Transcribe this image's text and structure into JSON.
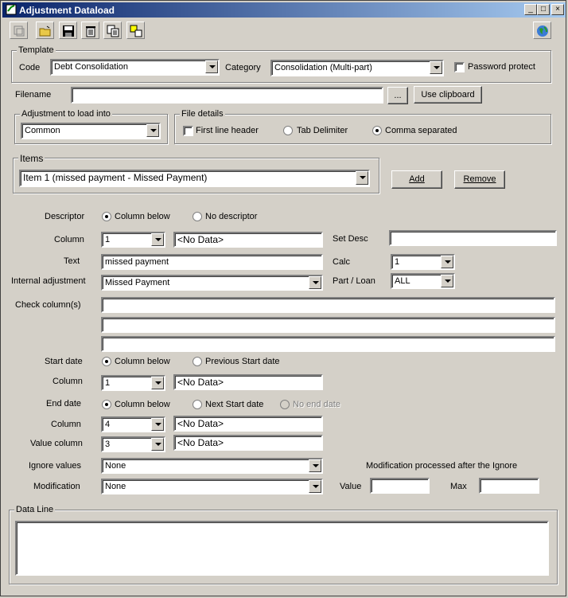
{
  "window": {
    "title": "Adjustment Dataload"
  },
  "toolbar": {
    "buttons": [
      "new-icon",
      "open-icon",
      "save-icon",
      "delete-icon",
      "copy-icon",
      "swap-icon"
    ],
    "help": "globe-icon"
  },
  "template": {
    "legend": "Template",
    "code_label": "Code",
    "code_value": "Debt Consolidation",
    "category_label": "Category",
    "category_value": "Consolidation (Multi-part)",
    "password_label": "Password protect"
  },
  "filename": {
    "label": "Filename",
    "value": "",
    "browse_label": "...",
    "clipboard_label": "Use clipboard"
  },
  "adjustment": {
    "legend": "Adjustment to load into",
    "value": "Common"
  },
  "file_details": {
    "legend": "File details",
    "first_line_header": "First line header",
    "tab": "Tab Delimiter",
    "comma": "Comma separated"
  },
  "items": {
    "legend": "Items",
    "value": "Item 1 (missed payment - Missed Payment)",
    "add_label": "Add",
    "remove_label": "Remove"
  },
  "descriptor": {
    "label": "Descriptor",
    "opt1": "Column below",
    "opt2": "No descriptor"
  },
  "column1": {
    "label": "Column",
    "value": "1",
    "data": "<No Data>"
  },
  "set_desc": {
    "label": "Set Desc",
    "value": ""
  },
  "text": {
    "label": "Text",
    "value": "missed payment"
  },
  "calc": {
    "label": "Calc",
    "value": "1"
  },
  "internal": {
    "label": "Internal adjustment",
    "value": "Missed Payment"
  },
  "part_loan": {
    "label": "Part / Loan",
    "value": "ALL"
  },
  "check_cols": {
    "label": "Check column(s)"
  },
  "start_date": {
    "label": "Start date",
    "opt1": "Column below",
    "opt2": "Previous Start date"
  },
  "column2": {
    "label": "Column",
    "value": "1",
    "data": "<No Data>"
  },
  "end_date": {
    "label": "End date",
    "opt1": "Column below",
    "opt2": "Next Start date",
    "opt3": "No end date"
  },
  "column3": {
    "label": "Column",
    "value": "4",
    "data": "<No Data>"
  },
  "value_column": {
    "label": "Value column",
    "value": "3",
    "data": "<No Data>"
  },
  "ignore": {
    "label": "Ignore values",
    "value": "None"
  },
  "mod_note": "Modification processed after the Ignore",
  "modification": {
    "label": "Modification",
    "value": "None",
    "value_label": "Value",
    "max_label": "Max"
  },
  "data_line": {
    "legend": "Data Line",
    "value": ""
  }
}
